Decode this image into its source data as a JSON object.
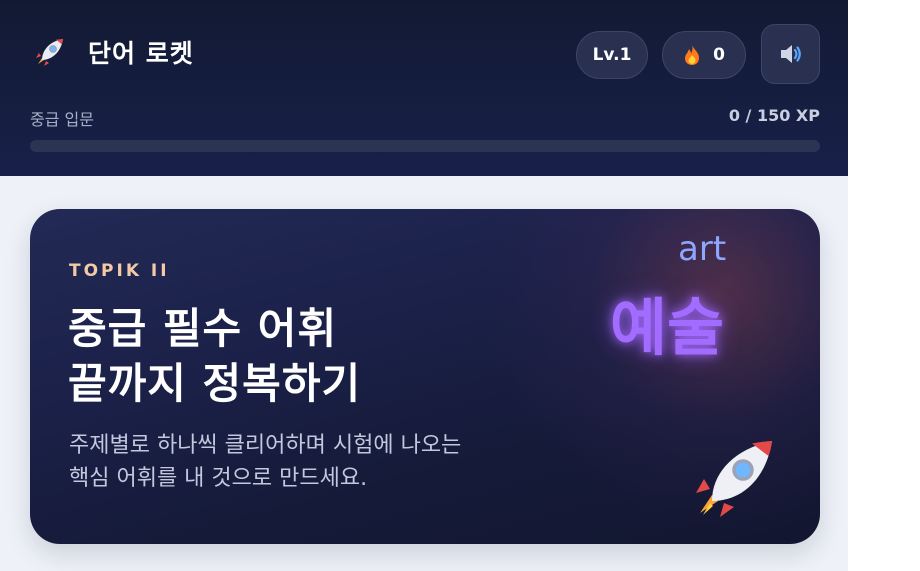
{
  "header": {
    "app_icon": "rocket-icon",
    "title": "단어 로켓",
    "level_label": "Lv.1",
    "streak_icon": "fire-icon",
    "streak_count": "0",
    "sound_icon": "speaker-icon",
    "xp": {
      "stage_label": "중급 입문",
      "value_label": "0 / 150 XP",
      "progress": 0
    }
  },
  "hero": {
    "eyebrow": "TOPIK II",
    "headline_line1": "중급 필수 어휘",
    "headline_line2": "끝까지 정복하기",
    "subtext_line1": "주제별로 하나씩 클리어하며 시험에 나오는",
    "subtext_line2": "핵심 어휘를 내 것으로 만드세요.",
    "word_en": "art",
    "word_ko": "예술",
    "rocket_icon": "rocket-icon"
  },
  "colors": {
    "header_bg": "#121a33",
    "hero_bg": "#1b2149",
    "eyebrow": "#f3c9a8",
    "glow_word": "#a16cff",
    "english_word": "#8fa6ff"
  }
}
